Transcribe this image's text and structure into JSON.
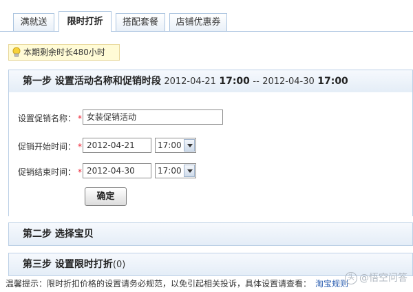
{
  "tabs": [
    "满就送",
    "限时打折",
    "搭配套餐",
    "店铺优惠券"
  ],
  "notice": {
    "icon": "lightbulb-icon",
    "text": "本期剩余时长480小时"
  },
  "step1": {
    "title": "第一步 设置活动名称和促销时段",
    "start_date": "2012-04-21",
    "start_time": "17:00",
    "separator": "--",
    "end_date": "2012-04-30",
    "end_time": "17:00"
  },
  "form": {
    "name_label": "设置促销名称：",
    "name_value": "女装促销活动",
    "start_label": "促销开始时间：",
    "start_date_value": "2012-04-21",
    "start_time_value": "17:00",
    "end_label": "促销结束时间：",
    "end_date_value": "2012-04-30",
    "end_time_value": "17:00",
    "required_mark": "*",
    "submit_label": "确定"
  },
  "step2": {
    "title": "第二步 选择宝贝"
  },
  "step3": {
    "title": "第三步 设置限时打折",
    "count": "(0)"
  },
  "footer": {
    "text": "温馨提示：限时折扣价格的设置请务必规范，以免引起相关投诉，具体设置请查看：",
    "link": "淘宝规则"
  },
  "watermark": {
    "badge": "头",
    "text": "@悟空问答"
  }
}
